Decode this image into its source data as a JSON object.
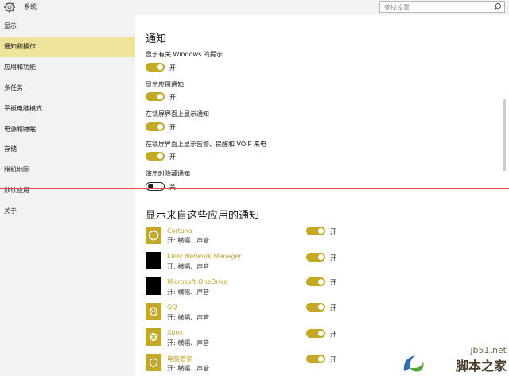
{
  "window": {
    "title": "系统",
    "search_placeholder": "查找设置"
  },
  "sidebar": {
    "items": [
      {
        "label": "显示",
        "active": false
      },
      {
        "label": "通知和操作",
        "active": true
      },
      {
        "label": "应用和功能",
        "active": false
      },
      {
        "label": "多任务",
        "active": false
      },
      {
        "label": "平板电脑模式",
        "active": false
      },
      {
        "label": "电源和睡眠",
        "active": false
      },
      {
        "label": "存储",
        "active": false
      },
      {
        "label": "脱机地图",
        "active": false
      },
      {
        "label": "默认应用",
        "active": false
      },
      {
        "label": "关于",
        "active": false
      }
    ]
  },
  "notifications": {
    "title": "通知",
    "settings": [
      {
        "label": "显示有关 Windows 的提示",
        "state": "开",
        "on": true
      },
      {
        "label": "显示应用通知",
        "state": "开",
        "on": true
      },
      {
        "label": "在锁屏界面上显示通知",
        "state": "开",
        "on": true
      },
      {
        "label": "在锁屏界面上显示告警、提醒和 VOIP 来电",
        "state": "开",
        "on": true
      },
      {
        "label": "演示时隐藏通知",
        "state": "关",
        "on": false
      }
    ]
  },
  "apps_section": {
    "title": "显示来自这些应用的通知",
    "apps": [
      {
        "name": "Cortana",
        "detail": "开: 横幅、声音",
        "state": "开",
        "on": true,
        "icon": "cortana-icon",
        "tile_color": "#c5a82a"
      },
      {
        "name": "Killer Network Manager",
        "detail": "开: 横幅、声音",
        "state": "开",
        "on": true,
        "icon": "killer-network-icon",
        "tile_color": "#000000"
      },
      {
        "name": "Microsoft OneDrive",
        "detail": "开: 横幅、声音",
        "state": "开",
        "on": true,
        "icon": "onedrive-icon",
        "tile_color": "#000000"
      },
      {
        "name": "QQ",
        "detail": "开: 横幅、声音",
        "state": "开",
        "on": true,
        "icon": "qq-icon",
        "tile_color": "#c5a82a"
      },
      {
        "name": "Xbox",
        "detail": "开: 横幅、声音",
        "state": "开",
        "on": true,
        "icon": "xbox-icon",
        "tile_color": "#c5a82a"
      },
      {
        "name": "电脑管家",
        "detail": "开: 横幅、声音",
        "state": "开",
        "on": true,
        "icon": "pc-manager-icon",
        "tile_color": "#c5a82a"
      }
    ]
  },
  "watermark": {
    "line1": "jb51.net",
    "line2": "脚本之家"
  },
  "colors": {
    "accent": "#c4a926",
    "sidebar_active": "#ede39a",
    "marker_line": "#e05050"
  }
}
